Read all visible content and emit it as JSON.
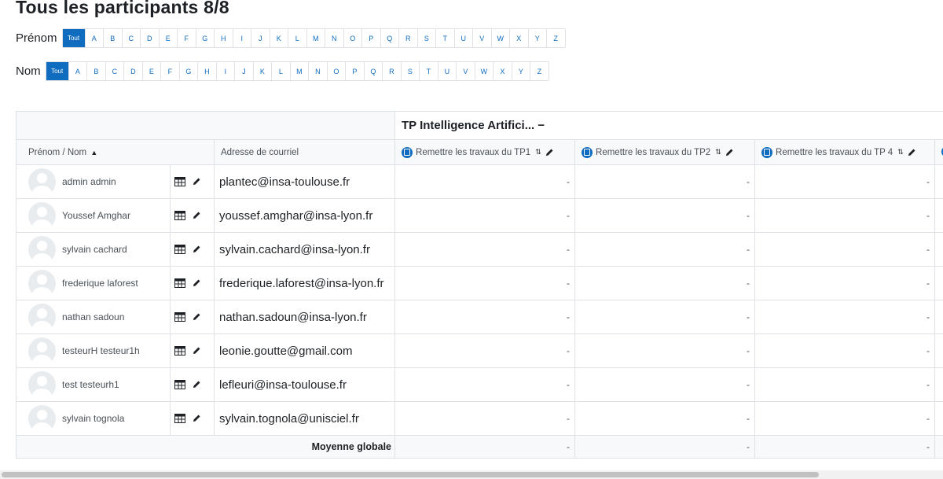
{
  "title": "Tous les participants 8/8",
  "initials": {
    "firstname_label": "Prénom",
    "lastname_label": "Nom",
    "all_label": "Tout",
    "letters": [
      "A",
      "B",
      "C",
      "D",
      "E",
      "F",
      "G",
      "H",
      "I",
      "J",
      "K",
      "L",
      "M",
      "N",
      "O",
      "P",
      "Q",
      "R",
      "S",
      "T",
      "U",
      "V",
      "W",
      "X",
      "Y",
      "Z"
    ]
  },
  "table": {
    "category": "TP Intelligence Artifici... −",
    "headers": {
      "name": "Prénom / Nom",
      "email": "Adresse de courriel",
      "assignments": [
        "Remettre les travaux du TP1",
        "Remettre les travaux du TP2",
        "Remettre les travaux du TP 4"
      ]
    },
    "rows": [
      {
        "name": "admin admin",
        "email": "plantec@insa-toulouse.fr",
        "grades": [
          "-",
          "-",
          "-"
        ]
      },
      {
        "name": "Youssef Amghar",
        "email": "youssef.amghar@insa-lyon.fr",
        "grades": [
          "-",
          "-",
          "-"
        ]
      },
      {
        "name": "sylvain cachard",
        "email": "sylvain.cachard@insa-lyon.fr",
        "grades": [
          "-",
          "-",
          "-"
        ]
      },
      {
        "name": "frederique laforest",
        "email": "frederique.laforest@insa-lyon.fr",
        "grades": [
          "-",
          "-",
          "-"
        ]
      },
      {
        "name": "nathan sadoun",
        "email": "nathan.sadoun@insa-lyon.fr",
        "grades": [
          "-",
          "-",
          "-"
        ]
      },
      {
        "name": "testeurH testeur1h",
        "email": "leonie.goutte@gmail.com",
        "grades": [
          "-",
          "-",
          "-"
        ]
      },
      {
        "name": "test testeurh1",
        "email": "lefleuri@insa-toulouse.fr",
        "grades": [
          "-",
          "-",
          "-"
        ]
      },
      {
        "name": "sylvain tognola",
        "email": "sylvain.tognola@unisciel.fr",
        "grades": [
          "-",
          "-",
          "-"
        ]
      }
    ],
    "average": {
      "label": "Moyenne globale",
      "values": [
        "-",
        "-",
        "-"
      ]
    }
  },
  "icons": {
    "grade_view": "table-icon",
    "edit": "pencil-icon",
    "assignment": "assignment-icon",
    "sort": "sort-icon"
  },
  "colors": {
    "accent": "#0f6cbf"
  }
}
